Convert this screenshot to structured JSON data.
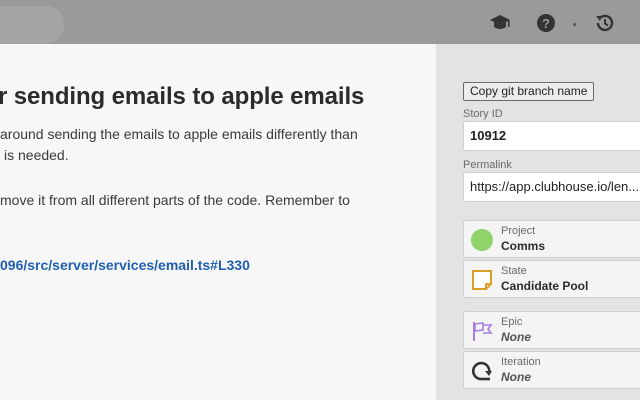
{
  "story": {
    "title": "r sending emails to apple emails",
    "description_lines": [
      "around sending the emails to apple emails differently than",
      "is needed.",
      "move it from all different parts of the code. Remember to"
    ],
    "link_text": "096/src/server/services/email.ts#L330"
  },
  "sidebar": {
    "copy_branch_label": "Copy git branch name",
    "story_id_label": "Story ID",
    "story_id_value": "10912",
    "permalink_label": "Permalink",
    "permalink_value": "https://app.clubhouse.io/len...",
    "project": {
      "label": "Project",
      "value": "Comms"
    },
    "state": {
      "label": "State",
      "value": "Candidate Pool"
    },
    "epic": {
      "label": "Epic",
      "value": "None"
    },
    "iteration": {
      "label": "Iteration",
      "value": "None"
    }
  },
  "icons": {
    "topbar": [
      "graduation-cap-icon",
      "help-icon",
      "history-icon"
    ],
    "project_color": "#8fd36a",
    "state_color": "#d9a12a",
    "epic_color": "#a57ee0"
  }
}
